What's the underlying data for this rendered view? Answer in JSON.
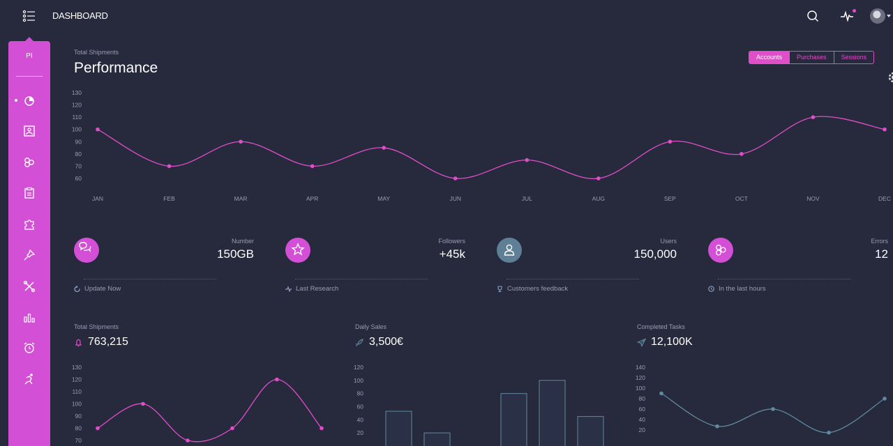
{
  "topbar": {
    "brand": "DASHBOARD",
    "icons": [
      "menu-icon",
      "search-icon",
      "pulse-icon",
      "avatar"
    ]
  },
  "sidebar": {
    "logo": "PI",
    "items": [
      "pie-chart-icon",
      "image-icon",
      "atom-icon",
      "clipboard-icon",
      "puzzle-icon",
      "pin-icon",
      "tools-icon",
      "bar-chart-icon",
      "alarm-icon",
      "run-icon"
    ]
  },
  "performance": {
    "subtitle": "Total Shipments",
    "title": "Performance",
    "tabs": [
      "Accounts",
      "Purchases",
      "Sessions"
    ],
    "active_tab": "Accounts"
  },
  "stats": [
    {
      "label": "Number",
      "value": "150GB",
      "footer": "Update Now",
      "icon": "chat-icon",
      "footer_icon": "refresh-icon",
      "color": "#d34fd6"
    },
    {
      "label": "Followers",
      "value": "+45k",
      "footer": "Last Research",
      "icon": "star-icon",
      "footer_icon": "pulse-icon",
      "color": "#d34fd6"
    },
    {
      "label": "Users",
      "value": "150,000",
      "footer": "Customers feedback",
      "icon": "user-icon",
      "footer_icon": "trophy-icon",
      "color": "#5f7f97"
    },
    {
      "label": "Errors",
      "value": "12",
      "footer": "In the last hours",
      "icon": "atom-icon",
      "footer_icon": "clock-icon",
      "color": "#d34fd6"
    }
  ],
  "bottom_cards": [
    {
      "subtitle": "Total Shipments",
      "value": "763,215",
      "icon": "bell-icon",
      "icon_color": "#e14eca"
    },
    {
      "subtitle": "Daily Sales",
      "value": "3,500€",
      "icon": "rocket-icon",
      "icon_color": "#5f7f97"
    },
    {
      "subtitle": "Completed Tasks",
      "value": "12,100K",
      "icon": "send-icon",
      "icon_color": "#5f7f97"
    }
  ],
  "colors": {
    "accent": "#e14eca",
    "teal": "#5f8aa0",
    "background": "#27293d"
  },
  "chart_data": [
    {
      "type": "line",
      "categories": [
        "JAN",
        "FEB",
        "MAR",
        "APR",
        "MAY",
        "JUN",
        "JUL",
        "AUG",
        "SEP",
        "OCT",
        "NOV",
        "DEC"
      ],
      "values": [
        100,
        70,
        90,
        70,
        85,
        60,
        75,
        60,
        90,
        80,
        110,
        100
      ],
      "yticks": [
        60,
        70,
        80,
        90,
        100,
        110,
        120,
        130
      ],
      "ylim": [
        60,
        130
      ],
      "color": "#e14eca"
    },
    {
      "type": "line",
      "values": [
        80,
        100,
        70,
        80,
        120,
        80
      ],
      "yticks": [
        70,
        80,
        90,
        100,
        110,
        120,
        130
      ],
      "ylim": [
        70,
        130
      ],
      "color": "#e14eca"
    },
    {
      "type": "bar",
      "values": [
        53,
        20,
        0,
        80,
        100,
        45
      ],
      "yticks": [
        20,
        40,
        60,
        80,
        100,
        120
      ],
      "ylim": [
        0,
        120
      ],
      "color": "#5f8aa0"
    },
    {
      "type": "line",
      "values": [
        90,
        27,
        60,
        15,
        80
      ],
      "yticks": [
        20,
        40,
        60,
        80,
        100,
        120,
        140
      ],
      "ylim": [
        0,
        140
      ],
      "color": "#5f8aa0"
    }
  ]
}
